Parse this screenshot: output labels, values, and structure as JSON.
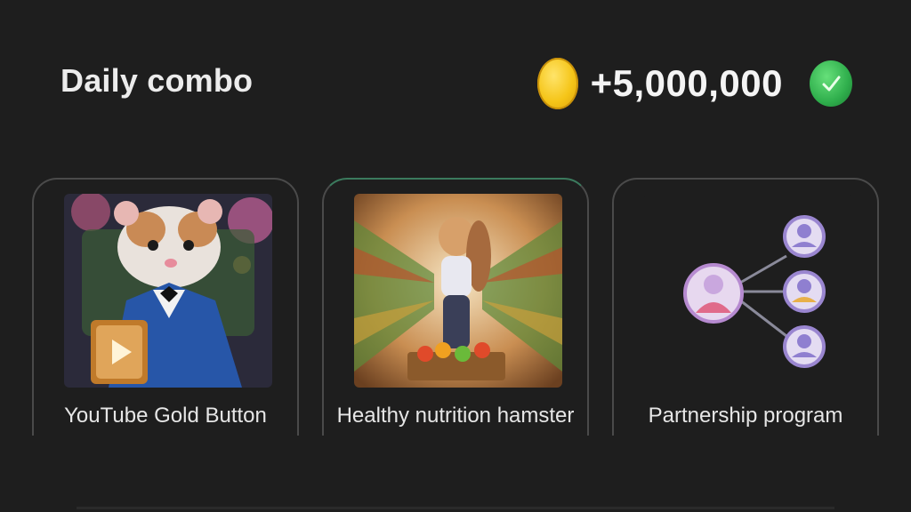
{
  "header": {
    "title": "Daily combo",
    "reward_amount": "+5,000,000",
    "coin_icon": "coin-icon",
    "status_icon": "check-icon"
  },
  "cards": [
    {
      "label": "YouTube Gold Button",
      "image": "hamster-youtube-gold-button-image"
    },
    {
      "label": "Healthy nutrition hamster",
      "image": "hamster-supermarket-image"
    },
    {
      "label": "Partnership program",
      "image": "partnership-network-icon"
    }
  ],
  "colors": {
    "background": "#1e1e1e",
    "coin": "#f5c518",
    "check": "#2fae4c",
    "card_border": "#4a4a4a",
    "active_accent": "#3b7a5d"
  }
}
